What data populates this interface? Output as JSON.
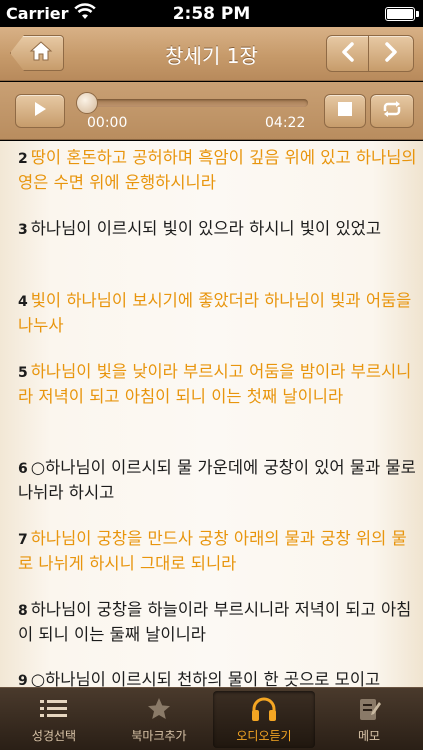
{
  "status_bar": {
    "carrier": "Carrier",
    "time": "2:58 PM"
  },
  "nav": {
    "title": "창세기 1장"
  },
  "audio": {
    "current_time": "00:00",
    "total_time": "04:22",
    "progress": 0
  },
  "verses": [
    {
      "num": "2",
      "text": "땅이 혼돈하고 공허하며 흑암이 깊음 위에 있고 하나님의 영은 수면 위에 운행하시니라",
      "highlight": true
    },
    {
      "num": "3",
      "text": "하나님이 이르시되 빛이 있으라 하시니 빛이 있었고",
      "highlight": false
    },
    {
      "num": "4",
      "text": "빛이 하나님이 보시기에 좋았더라 하나님이 빛과 어둠을 나누사",
      "highlight": true
    },
    {
      "num": "5",
      "text": "하나님이 빛을 낮이라 부르시고 어둠을 밤이라 부르시니라 저녁이 되고 아침이 되니 이는 첫째 날이니라",
      "highlight": true
    },
    {
      "num": "6",
      "text": "○하나님이 이르시되 물 가운데에 궁창이 있어 물과 물로 나뉘라 하시고",
      "highlight": false
    },
    {
      "num": "7",
      "text": "하나님이 궁창을 만드사 궁창 아래의 물과 궁창 위의 물로 나뉘게 하시니 그대로 되니라",
      "highlight": true
    },
    {
      "num": "8",
      "text": "하나님이 궁창을 하늘이라 부르시니라 저녁이 되고 아침이 되니 이는 둘째 날이니라",
      "highlight": false
    },
    {
      "num": "9",
      "text": "○하나님이 이르시되 천하의 물이 한 곳으로 모이고",
      "highlight": false
    }
  ],
  "tabs": [
    {
      "label": "성경선택",
      "icon": "list-icon",
      "active": false
    },
    {
      "label": "북마크추가",
      "icon": "star-icon",
      "active": false
    },
    {
      "label": "오디오듣기",
      "icon": "headphones-icon",
      "active": true
    },
    {
      "label": "메모",
      "icon": "memo-icon",
      "active": false
    }
  ],
  "colors": {
    "highlight": "#e8950d",
    "nav": "#c69a6a",
    "tab_active": "#f5a623"
  }
}
